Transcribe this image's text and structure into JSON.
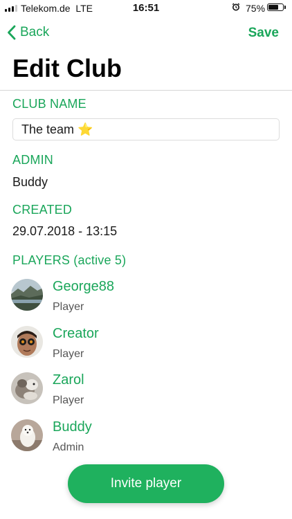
{
  "status_bar": {
    "carrier": "Telekom.de",
    "network": "LTE",
    "time": "16:51",
    "battery_text": "75%",
    "battery_level": 0.75,
    "signal_bars_active": 3,
    "signal_bars_total": 4
  },
  "nav": {
    "back_label": "Back",
    "save_label": "Save"
  },
  "title": "Edit Club",
  "club_name": {
    "label": "CLUB NAME",
    "value": "The team ⭐"
  },
  "admin": {
    "label": "ADMIN",
    "value": "Buddy"
  },
  "created": {
    "label": "CREATED",
    "value": "29.07.2018 - 13:15"
  },
  "players": {
    "label": "PLAYERS (active 5)",
    "items": [
      {
        "name": "George88",
        "role": "Player",
        "avatar": "landscape"
      },
      {
        "name": "Creator",
        "role": "Player",
        "avatar": "face"
      },
      {
        "name": "Zarol",
        "role": "Player",
        "avatar": "animal"
      },
      {
        "name": "Buddy",
        "role": "Admin",
        "avatar": "dog"
      }
    ]
  },
  "invite_button": {
    "label": "Invite player"
  },
  "colors": {
    "accent": "#1aa65a",
    "button": "#1fb15e"
  }
}
